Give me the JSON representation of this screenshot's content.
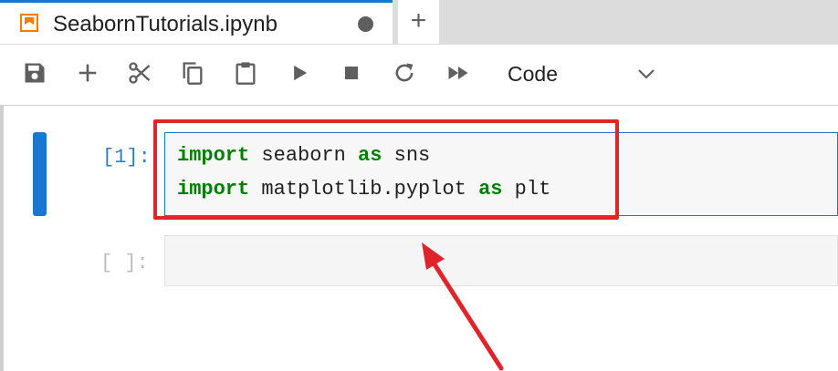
{
  "tab": {
    "title": "SeabornTutorials.ipynb",
    "add_label": "+"
  },
  "toolbar": {
    "buttons": [
      "save-icon",
      "add-icon",
      "cut-icon",
      "copy-icon",
      "paste-icon",
      "run-icon",
      "stop-icon",
      "restart-icon",
      "run-all-icon"
    ],
    "cell_type": "Code"
  },
  "cells": [
    {
      "prompt": "[1]:",
      "lines": [
        {
          "kw1": "import",
          "mod": " seaborn ",
          "kw2": "as",
          "alias": " sns"
        },
        {
          "kw1": "import",
          "mod": " matplotlib.pyplot ",
          "kw2": "as",
          "alias": " plt"
        }
      ]
    },
    {
      "prompt": "[ ]:"
    }
  ],
  "colors": {
    "accent": "#1976d2",
    "keyword": "#008000",
    "annotation": "#e0242b",
    "tab_icon": "#f57c00"
  }
}
